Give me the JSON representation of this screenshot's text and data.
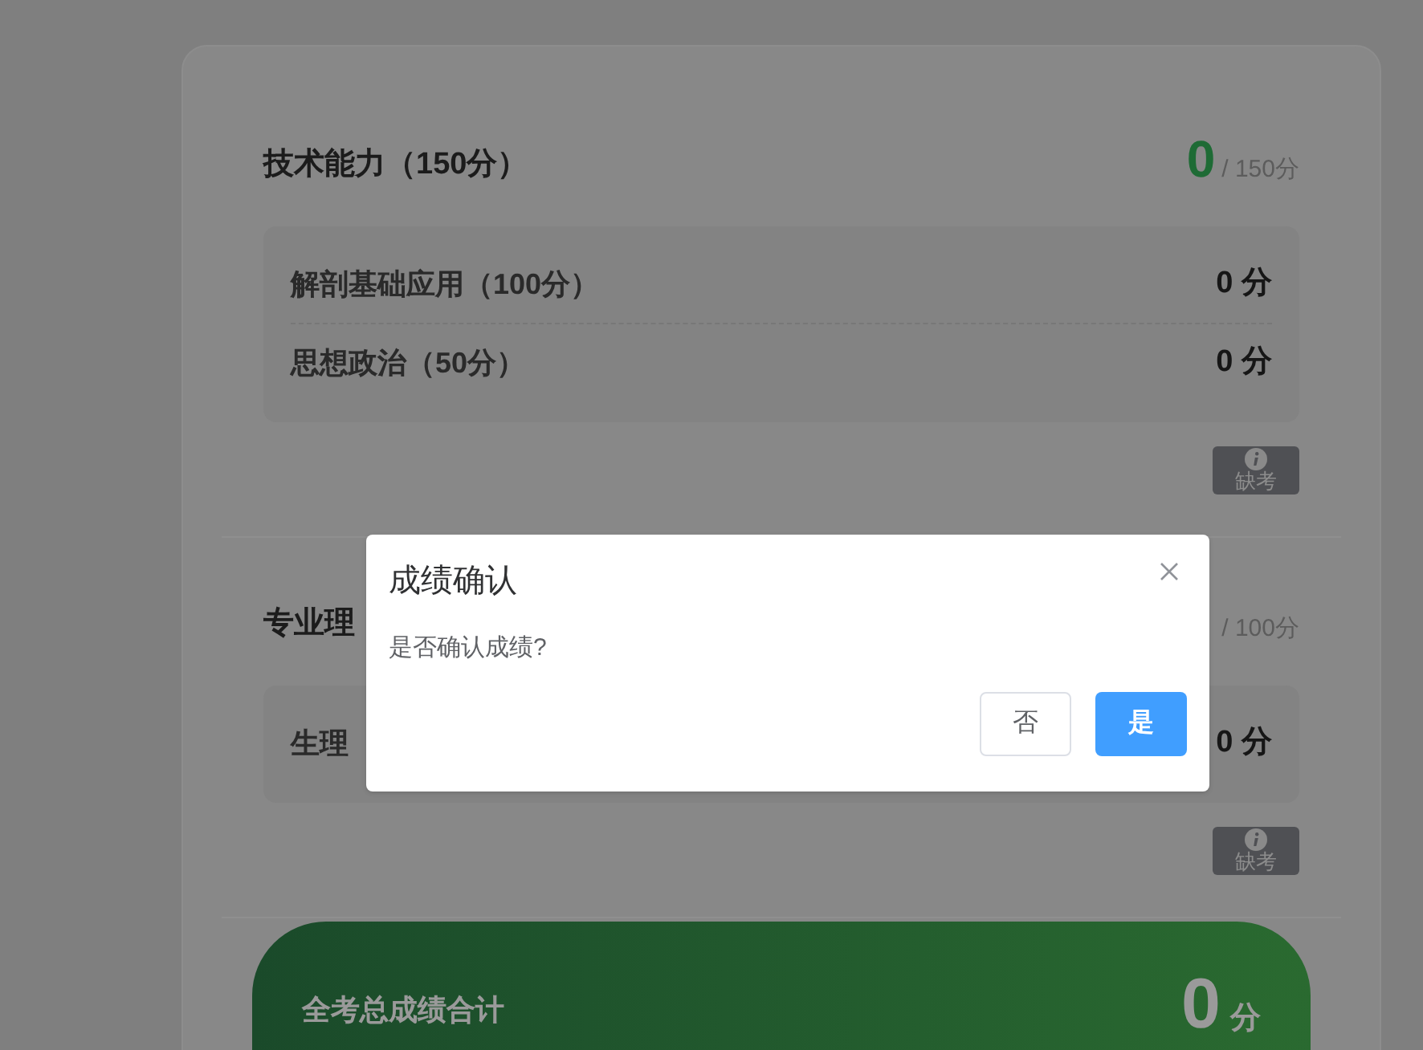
{
  "sections": [
    {
      "title": "技术能力（150分）",
      "score": "0",
      "max": "/ 150分",
      "items": [
        {
          "label": "解剖基础应用（100分）",
          "score": "0 分"
        },
        {
          "label": "思想政治（50分）",
          "score": "0 分"
        }
      ],
      "badge": "缺考"
    },
    {
      "title": "专业理",
      "max": "/ 100分",
      "items": [
        {
          "label": "生理",
          "score": "0 分"
        }
      ],
      "badge": "缺考"
    }
  ],
  "total": {
    "label": "全考总成绩合计",
    "score": "0",
    "unit": "分"
  },
  "dialog": {
    "title": "成绩确认",
    "message": "是否确认成绩?",
    "buttons": [
      {
        "label": "否",
        "kind": "default"
      },
      {
        "label": "是",
        "kind": "primary"
      }
    ]
  }
}
